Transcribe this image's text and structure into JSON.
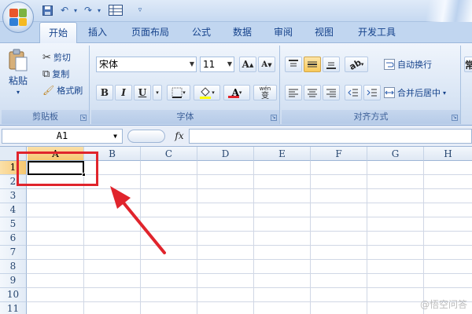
{
  "title_bar": {
    "quick_access": [
      {
        "name": "save-icon",
        "glyph": "💾"
      },
      {
        "name": "undo-icon",
        "glyph": "↶"
      },
      {
        "name": "redo-icon",
        "glyph": "↷"
      },
      {
        "name": "format-table-icon",
        "glyph": "▦"
      }
    ]
  },
  "tabs": [
    {
      "label": "开始",
      "active": true
    },
    {
      "label": "插入"
    },
    {
      "label": "页面布局"
    },
    {
      "label": "公式"
    },
    {
      "label": "数据"
    },
    {
      "label": "审阅"
    },
    {
      "label": "视图"
    },
    {
      "label": "开发工具"
    }
  ],
  "ribbon": {
    "clipboard": {
      "paste": "粘贴",
      "cut": "剪切",
      "copy": "复制",
      "format_painter": "格式刷",
      "group_label": "剪贴板"
    },
    "font": {
      "font_name": "宋体",
      "font_size": "11",
      "grow": "A",
      "shrink": "A",
      "bold": "B",
      "italic": "I",
      "underline": "U",
      "font_color_letter": "A",
      "phonetic": "wén",
      "phonetic_char": "变",
      "group_label": "字体"
    },
    "alignment": {
      "wrap_text": "自动换行",
      "merge_center": "合并后居中",
      "group_label": "对齐方式"
    }
  },
  "formula_bar": {
    "name_box": "A1",
    "fx": "fx",
    "formula": ""
  },
  "sheet": {
    "columns": [
      "A",
      "B",
      "C",
      "D",
      "E",
      "F",
      "G",
      "H"
    ],
    "rows": [
      "1",
      "2",
      "3",
      "4",
      "5",
      "6",
      "7",
      "8",
      "9",
      "10",
      "11"
    ],
    "active_cell": "A1"
  },
  "watermark": "@悟空问答",
  "colors": {
    "annotation_red": "#e0242c",
    "ribbon_blue": "#c1d6f0",
    "selection_orange": "#f6c770"
  }
}
